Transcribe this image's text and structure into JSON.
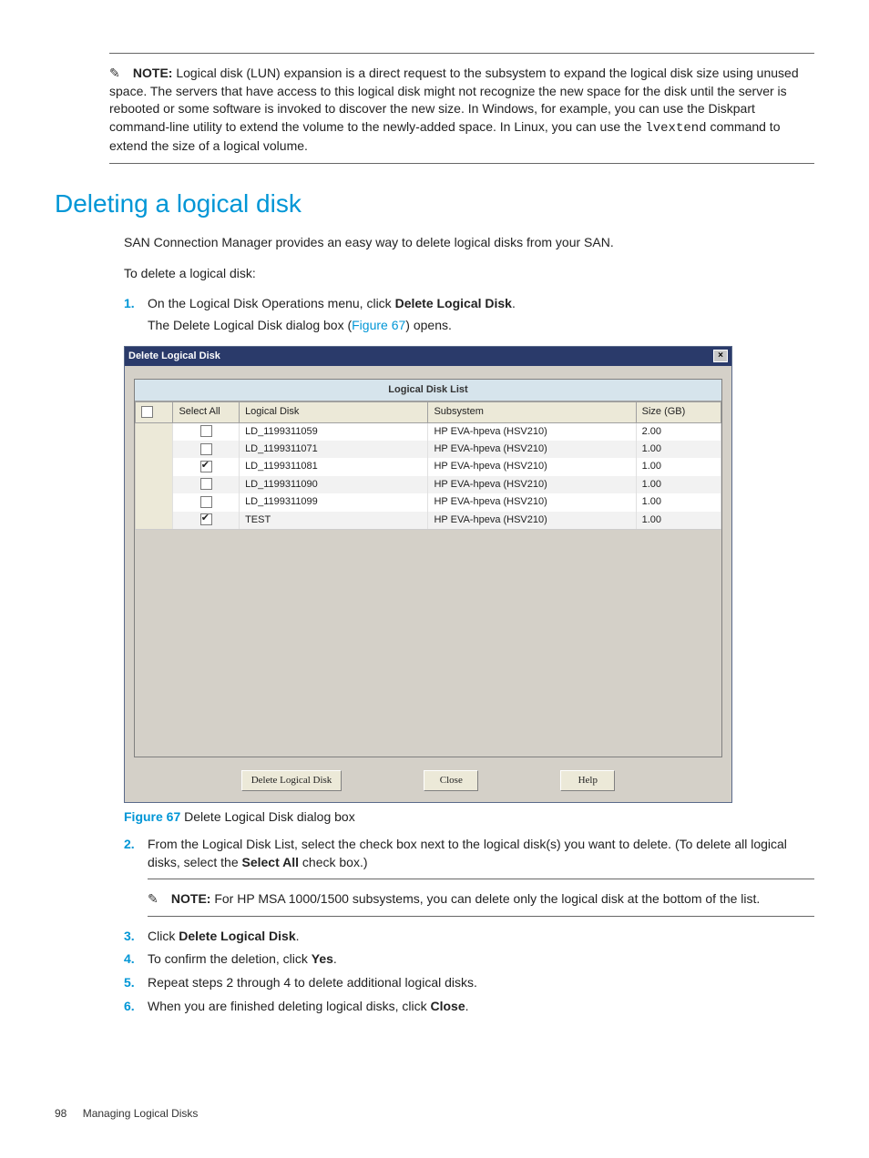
{
  "note1": {
    "label": "NOTE:",
    "text_a": "Logical disk (LUN) expansion is a direct request to the subsystem to expand the logical disk size using unused space. The servers that have access to this logical disk might not recognize the new space for the disk until the server is rebooted or some software is invoked to discover the new size. In Windows, for example, you can use the Diskpart command-line utility to extend the volume to the newly-added space. In Linux, you can use the ",
    "code": "lvextend",
    "text_b": " command to extend the size of a logical volume."
  },
  "heading": "Deleting a logical disk",
  "intro": "SAN Connection Manager provides an easy way to delete logical disks from your SAN.",
  "lead": "To delete a logical disk:",
  "steps": {
    "s1": {
      "num": "1.",
      "text_a": "On the Logical Disk Operations menu, click ",
      "bold": "Delete Logical Disk",
      "text_b": ".",
      "sub_a": "The Delete Logical Disk dialog box (",
      "link": "Figure 67",
      "sub_b": ") opens."
    },
    "s2": {
      "num": "2.",
      "text_a": "From the Logical Disk List, select the check box next to the logical disk(s) you want to delete. (To delete all logical disks, select the ",
      "bold": "Select All",
      "text_b": " check box.)"
    },
    "s3": {
      "num": "3.",
      "text_a": "Click ",
      "bold": "Delete Logical Disk",
      "text_b": "."
    },
    "s4": {
      "num": "4.",
      "text_a": "To confirm the deletion, click ",
      "bold": "Yes",
      "text_b": "."
    },
    "s5": {
      "num": "5.",
      "text": "Repeat steps 2 through 4 to delete additional logical disks."
    },
    "s6": {
      "num": "6.",
      "text_a": "When you are finished deleting logical disks, click ",
      "bold": "Close",
      "text_b": "."
    }
  },
  "figure": {
    "label": "Figure 67",
    "caption": " Delete Logical Disk dialog box"
  },
  "note2": {
    "label": "NOTE:",
    "text": "For HP MSA 1000/1500 subsystems, you can delete only the logical disk at the bottom of the list."
  },
  "dialog": {
    "title": "Delete Logical Disk",
    "list_title": "Logical Disk List",
    "cols": {
      "selall": "Select All",
      "name": "Logical Disk",
      "sub": "Subsystem",
      "size": "Size (GB)"
    },
    "rows": [
      {
        "checked": false,
        "name": "LD_1199311059",
        "sub": "HP EVA-hpeva (HSV210)",
        "size": "2.00"
      },
      {
        "checked": false,
        "name": "LD_1199311071",
        "sub": "HP EVA-hpeva (HSV210)",
        "size": "1.00"
      },
      {
        "checked": true,
        "name": "LD_1199311081",
        "sub": "HP EVA-hpeva (HSV210)",
        "size": "1.00"
      },
      {
        "checked": false,
        "name": "LD_1199311090",
        "sub": "HP EVA-hpeva (HSV210)",
        "size": "1.00"
      },
      {
        "checked": false,
        "name": "LD_1199311099",
        "sub": "HP EVA-hpeva (HSV210)",
        "size": "1.00"
      },
      {
        "checked": true,
        "name": "TEST",
        "sub": "HP EVA-hpeva (HSV210)",
        "size": "1.00"
      }
    ],
    "buttons": {
      "delete": "Delete Logical Disk",
      "close": "Close",
      "help": "Help"
    }
  },
  "footer": {
    "page": "98",
    "chapter": "Managing Logical Disks"
  }
}
